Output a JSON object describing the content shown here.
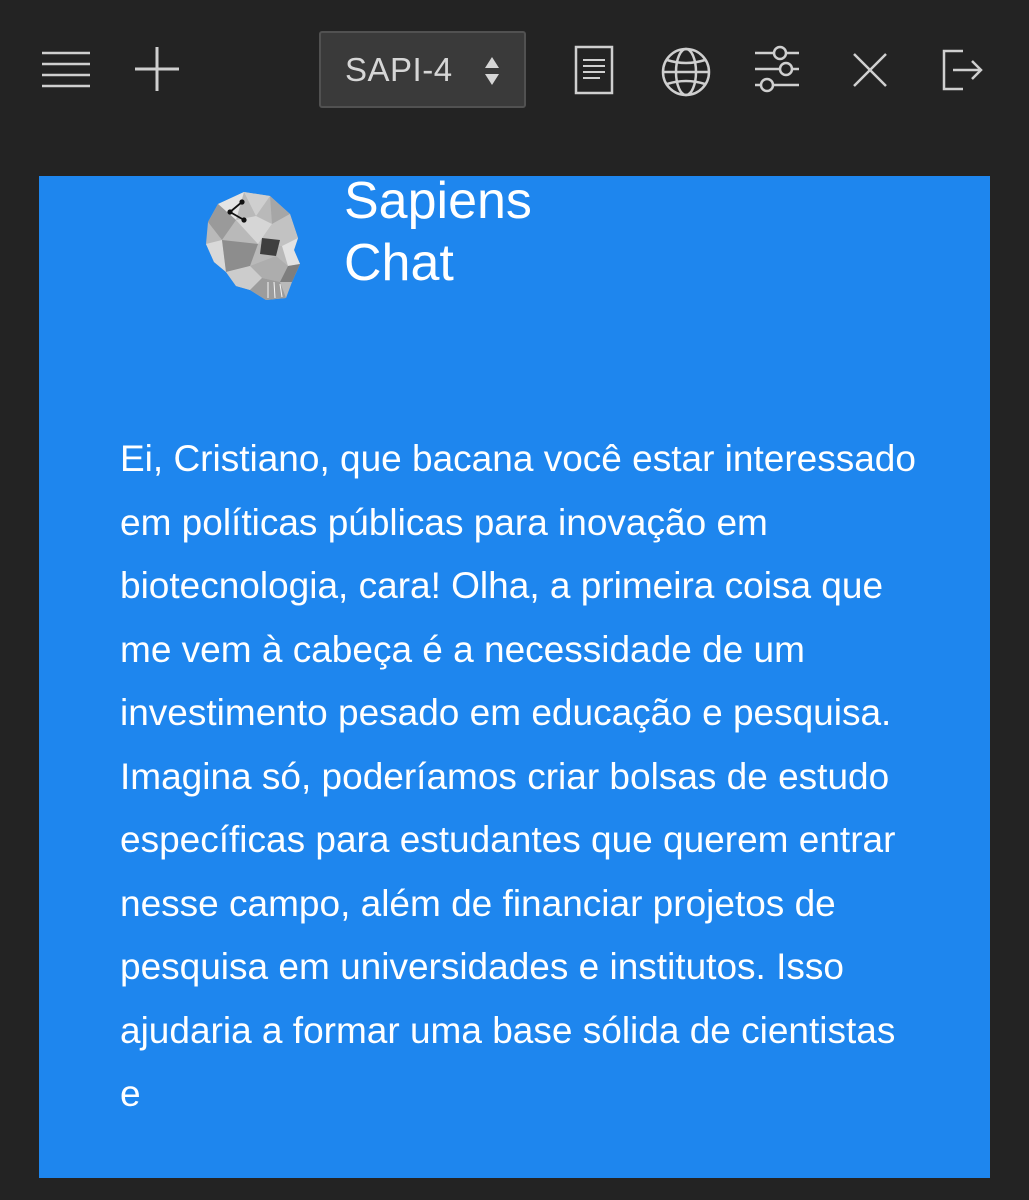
{
  "toolbar": {
    "model_select": {
      "selected": "SAPI-4"
    },
    "icons": {
      "menu": "menu-icon",
      "new_chat": "plus-icon",
      "document": "document-icon",
      "web": "globe-icon",
      "settings": "sliders-icon",
      "close": "close-icon",
      "logout": "logout-icon"
    }
  },
  "chat": {
    "app_title_line1": "Sapiens",
    "app_title_line2": "Chat",
    "logo_icon": "skull-logo-icon",
    "message": "Ei, Cristiano, que bacana você estar interessado em políticas públicas para inovação em biotecnologia, cara! Olha, a primeira coisa que me vem à cabeça é a necessidade de um investimento pesado em educação e pesquisa. Imagina só, poderíamos criar bolsas de estudo específicas para estudantes que querem entrar nesse campo, além de financiar projetos de pesquisa em universidades e institutos. Isso ajudaria a formar uma base sólida de cientistas e"
  },
  "colors": {
    "background": "#232323",
    "card": "#1e86ee",
    "icon": "#cfcfcf",
    "text": "#ffffff"
  }
}
